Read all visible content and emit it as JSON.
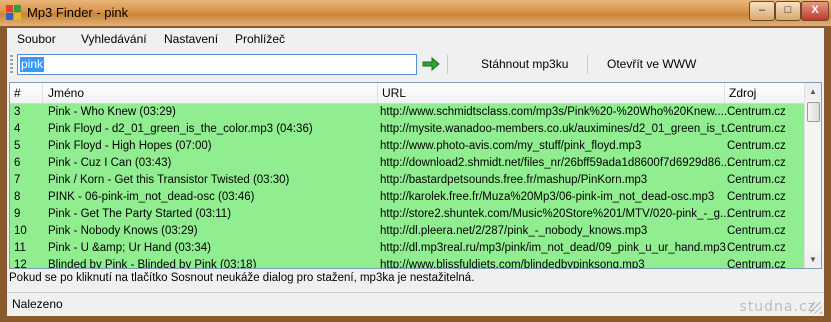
{
  "window": {
    "title": "Mp3 Finder - pink",
    "buttons": {
      "minimize": "–",
      "maximize": "□",
      "close": "X"
    }
  },
  "menu": [
    {
      "label": "Soubor"
    },
    {
      "label": "Vyhledávání"
    },
    {
      "label": "Nastavení"
    },
    {
      "label": "Prohlížeč"
    }
  ],
  "toolbar": {
    "search_value": "pink",
    "go_icon": "green-arrow-icon",
    "download_label": "Stáhnout mp3ku",
    "open_www_label": "Otevřít ve WWW"
  },
  "grid": {
    "columns": [
      "#",
      "Jméno",
      "URL",
      "Zdroj"
    ],
    "row_color": "#90ee90",
    "rows": [
      {
        "num": "3",
        "name": "Pink  -  Who Knew (03:29)",
        "url": "http://www.schmidtsclass.com/mp3s/Pink%20-%20Who%20Knew....",
        "source": "Centrum.cz"
      },
      {
        "num": "4",
        "name": "Pink Floyd  - d2_01_green_is_the_color.mp3 (04:36)",
        "url": "http://mysite.wanadoo-members.co.uk/auximines/d2_01_green_is_t...",
        "source": "Centrum.cz"
      },
      {
        "num": "5",
        "name": "Pink Floyd  -  High Hopes (07:00)",
        "url": "http://www.photo-avis.com/my_stuff/pink_floyd.mp3",
        "source": "Centrum.cz"
      },
      {
        "num": "6",
        "name": "Pink  -  Cuz I Can (03:43)",
        "url": "http://download2.shmidt.net/files_nr/26bff59ada1d8600f7d6929d86...",
        "source": "Centrum.cz"
      },
      {
        "num": "7",
        "name": "Pink / Korn  -  Get this Transistor Twisted (03:30)",
        "url": "http://bastardpetsounds.free.fr/mashup/PinKorn.mp3",
        "source": "Centrum.cz"
      },
      {
        "num": "8",
        "name": "PINK  -  06-pink-im_not_dead-osc (03:46)",
        "url": "http://karolek.free.fr/Muza%20Mp3/06-pink-im_not_dead-osc.mp3",
        "source": "Centrum.cz"
      },
      {
        "num": "9",
        "name": "Pink  -  Get The Party Started (03:11)",
        "url": "http://store2.shuntek.com/Music%20Store%201/MTV/020-pink_-_g...",
        "source": "Centrum.cz"
      },
      {
        "num": "10",
        "name": "Pink  -  Nobody Knows (03:29)",
        "url": "http://dl.pleera.net/2/287/pink_-_nobody_knows.mp3",
        "source": "Centrum.cz"
      },
      {
        "num": "11",
        "name": "Pink  -  U &amp; Ur Hand (03:34)",
        "url": "http://dl.mp3real.ru/mp3/pink/im_not_dead/09_pink_u_ur_hand.mp3",
        "source": "Centrum.cz"
      },
      {
        "num": "12",
        "name": "Blinded by Pink  -  Blinded by Pink (03:18)",
        "url": "http://www.blissfuldiets.com/blindedbypinksong.mp3",
        "source": "Centrum.cz"
      }
    ]
  },
  "hint": "Pokud se po kliknutí na tlačítko Sosnout neukáže dialog pro stažení, mp3ka je nestažitelná.",
  "status": "Nalezeno",
  "watermark": "studna.cz"
}
